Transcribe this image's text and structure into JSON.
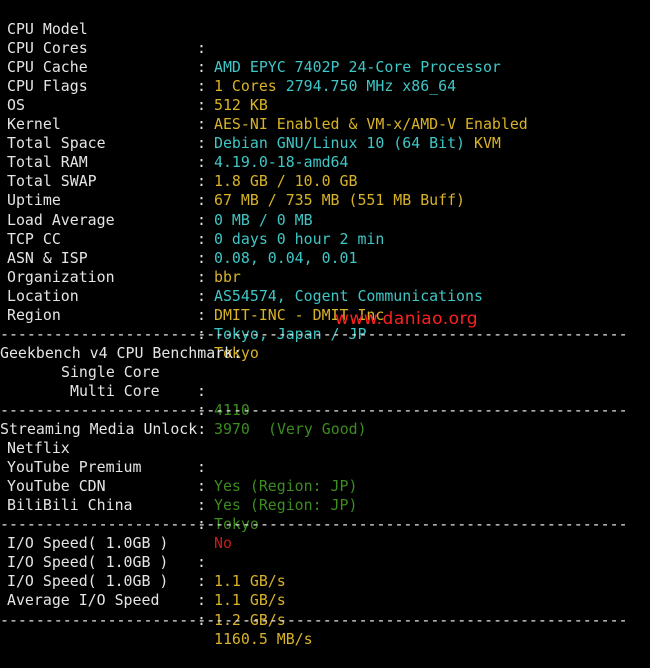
{
  "system_info": [
    {
      "label": "CPU Model",
      "segments": [
        {
          "text": "AMD EPYC 7402P 24-Core Processor",
          "color": "cyan"
        }
      ]
    },
    {
      "label": "CPU Cores",
      "segments": [
        {
          "text": "1 Cores ",
          "color": "yellow"
        },
        {
          "text": "2794.750 MHz x86_64",
          "color": "cyan"
        }
      ]
    },
    {
      "label": "CPU Cache",
      "segments": [
        {
          "text": "512 KB",
          "color": "yellow"
        }
      ]
    },
    {
      "label": "CPU Flags",
      "segments": [
        {
          "text": "AES-NI Enabled & VM-x/AMD-V Enabled",
          "color": "yellow"
        }
      ]
    },
    {
      "label": "OS",
      "segments": [
        {
          "text": "Debian GNU/Linux 10 (64 Bit) ",
          "color": "cyan"
        },
        {
          "text": "KVM",
          "color": "yellow"
        }
      ]
    },
    {
      "label": "Kernel",
      "segments": [
        {
          "text": "4.19.0-18-amd64",
          "color": "cyan"
        }
      ]
    },
    {
      "label": "Total Space",
      "segments": [
        {
          "text": "1.8 GB / 10.0 GB",
          "color": "yellow"
        }
      ]
    },
    {
      "label": "Total RAM",
      "segments": [
        {
          "text": "67 MB / 735 MB (551 MB Buff)",
          "color": "yellow"
        }
      ]
    },
    {
      "label": "Total SWAP",
      "segments": [
        {
          "text": "0 MB / 0 MB",
          "color": "cyan"
        }
      ]
    },
    {
      "label": "Uptime",
      "segments": [
        {
          "text": "0 days 0 hour 2 min",
          "color": "cyan"
        }
      ]
    },
    {
      "label": "Load Average",
      "segments": [
        {
          "text": "0.08, 0.04, 0.01",
          "color": "cyan"
        }
      ]
    },
    {
      "label": "TCP CC",
      "segments": [
        {
          "text": "bbr",
          "color": "yellow"
        }
      ]
    },
    {
      "label": "ASN & ISP",
      "segments": [
        {
          "text": "AS54574, Cogent Communications",
          "color": "cyan"
        }
      ]
    },
    {
      "label": "Organization",
      "segments": [
        {
          "text": "DMIT-INC - DMIT Inc",
          "color": "yellow"
        }
      ]
    },
    {
      "label": "Location",
      "segments": [
        {
          "text": "Tokyo, Japan / JP",
          "color": "cyan"
        }
      ]
    },
    {
      "label": "Region",
      "segments": [
        {
          "text": "Tokyo",
          "color": "yellow"
        }
      ]
    }
  ],
  "separator": ":",
  "divider": "----------------------------------------------------------------------",
  "watermark": "www.daniao.org",
  "geekbench": {
    "title": "Geekbench v4 CPU Benchmark:",
    "single_label": "Single Core",
    "single_score": "4110",
    "single_rating": "(Very Good)",
    "multi_label": "Multi Core",
    "multi_score": "3970"
  },
  "streaming": {
    "title": "Streaming Media Unlock:",
    "items": [
      {
        "label": "Netflix",
        "value": "Yes (Region: JP)",
        "color": "green"
      },
      {
        "label": "YouTube Premium",
        "value": "Yes (Region: JP)",
        "color": "green"
      },
      {
        "label": "YouTube CDN",
        "value": "Tokyo",
        "color": "green"
      },
      {
        "label": "BiliBili China",
        "value": "No",
        "color": "red"
      }
    ]
  },
  "io": [
    {
      "label": "I/O Speed( 1.0GB )",
      "value": "1.1 GB/s"
    },
    {
      "label": "I/O Speed( 1.0GB )",
      "value": "1.1 GB/s"
    },
    {
      "label": "I/O Speed( 1.0GB )",
      "value": "1.2 GB/s"
    },
    {
      "label": "Average I/O Speed",
      "value": "1160.5 MB/s"
    }
  ],
  "colors": {
    "background": "#000000",
    "label": "#e5e5e5",
    "cyan": "#3fc6c6",
    "yellow": "#d8b327",
    "green": "#3c8c1f",
    "red": "#c51e14",
    "watermark": "#ff2020"
  }
}
